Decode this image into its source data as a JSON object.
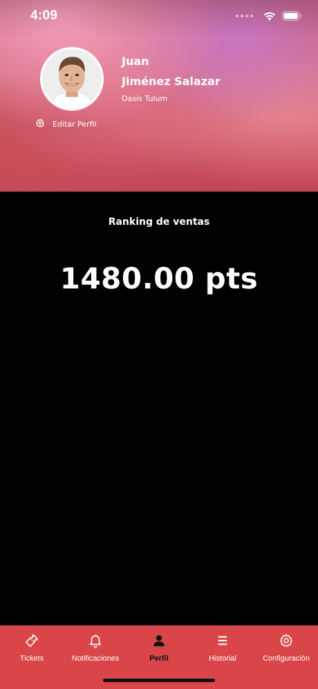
{
  "status_bar": {
    "time": "4:09"
  },
  "profile": {
    "first_name": "Juan",
    "last_name": "Jiménez Salazar",
    "location": "Oasis Tulum",
    "edit_label": "Editar Perfil"
  },
  "ranking": {
    "title": "Ranking de ventas",
    "value": "1480.00 pts"
  },
  "tab_bar": {
    "active": "Perfil",
    "items": [
      {
        "label": "Tickets",
        "icon": "ticket-icon"
      },
      {
        "label": "Notificaciones",
        "icon": "bell-icon"
      },
      {
        "label": "Perfil",
        "icon": "user-icon"
      },
      {
        "label": "Historial",
        "icon": "list-icon"
      },
      {
        "label": "Configuración",
        "icon": "gear-icon"
      }
    ]
  },
  "colors": {
    "tab_bar_background": "#d94548",
    "page_background": "#000000",
    "text": "#ffffff"
  }
}
